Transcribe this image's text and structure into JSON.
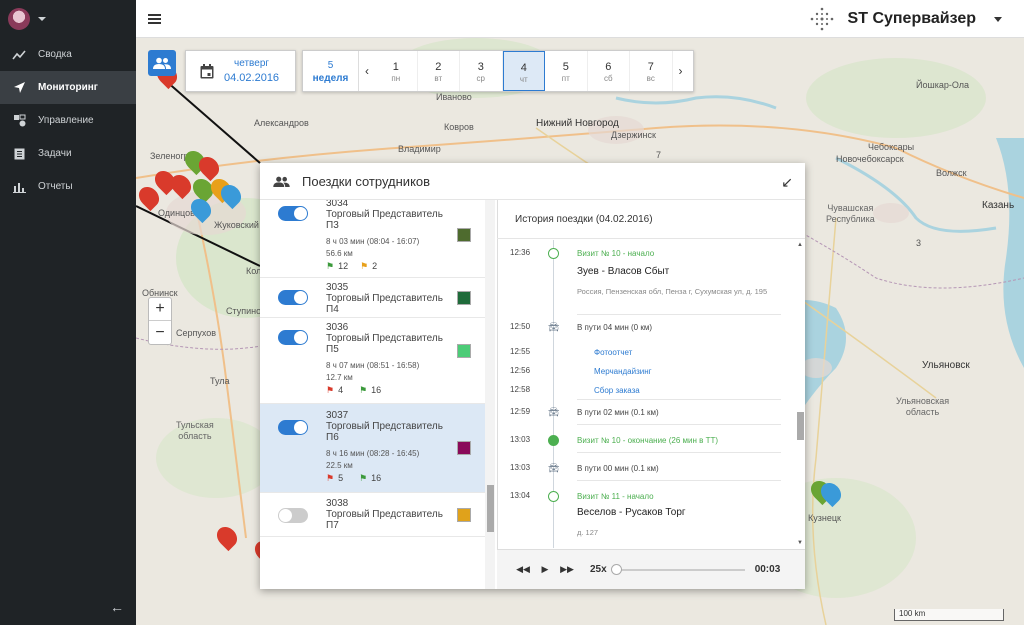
{
  "app": {
    "brand_name": "ST Супервайзер"
  },
  "sidebar": {
    "items": [
      {
        "label": "Сводка",
        "icon": "trend-icon"
      },
      {
        "label": "Мониторинг",
        "icon": "navigation-arrow-icon",
        "active": true
      },
      {
        "label": "Управление",
        "icon": "management-icon"
      },
      {
        "label": "Задачи",
        "icon": "clipboard-icon"
      },
      {
        "label": "Отчеты",
        "icon": "bar-chart-icon"
      }
    ]
  },
  "date_picker": {
    "weekday": "четверг",
    "date": "04.02.2016"
  },
  "week": {
    "number": "5",
    "label": "неделя",
    "days": [
      {
        "num": "1",
        "name": "пн"
      },
      {
        "num": "2",
        "name": "вт"
      },
      {
        "num": "3",
        "name": "ср"
      },
      {
        "num": "4",
        "name": "чт",
        "active": true
      },
      {
        "num": "5",
        "name": "пт"
      },
      {
        "num": "6",
        "name": "сб"
      },
      {
        "num": "7",
        "name": "вс"
      }
    ]
  },
  "map": {
    "labels": {
      "nizhny": "Нижний Новгород",
      "dzerzhinsk": "Дзержинск",
      "vladimir": "Владимир",
      "kovrov": "Ковров",
      "kazan": "Казань",
      "cheboksary": "Чебоксары",
      "novocheboksarsk": "Новочебоксарск",
      "yoshkar": "Йошкар-Ола",
      "volzhsk": "Волжск",
      "chuvash": "Чувашская\nРеспублика",
      "ulyanovsk": "Ульяновск",
      "ulyanovsk_obl": "Ульяновская\nобласть",
      "tula_obl": "Тульская\nобласть",
      "tula": "Тула",
      "kuznetsk": "Кузнецк",
      "aleksandrov": "Александров",
      "zhukovsky": "Жуковский",
      "odintsovo": "Одинцово",
      "zelenograd": "Зеленоград",
      "stupino": "Ступино",
      "kolomna": "Коломна",
      "serpukhov": "Серпухов",
      "obninsk": "Обнинск",
      "ivanovo": "Иваново",
      "r7": "7",
      "r3": "3",
      "scale": "100 km"
    }
  },
  "panel": {
    "title": "Поездки сотрудников",
    "employees": [
      {
        "code": "3034",
        "role": "Торговый Представитель П3",
        "duration": "8 ч 03 мин (08:04 - 16:07)",
        "distance": "56.6 км",
        "flag_a": "12",
        "flag_b": "2",
        "color": "#4e6b2e",
        "on": true,
        "flag_a_type": "green",
        "flag_b_type": "yellow"
      },
      {
        "code": "3035",
        "role": "Торговый Представитель П4",
        "duration": "",
        "distance": "",
        "flag_a": "",
        "flag_b": "",
        "color": "#1f6b3a",
        "on": true
      },
      {
        "code": "3036",
        "role": "Торговый Представитель П5",
        "duration": "8 ч 07 мин (08:51 - 16:58)",
        "distance": "12.7 км",
        "flag_a": "4",
        "flag_b": "16",
        "color": "#4ccc77",
        "on": true,
        "flag_a_type": "red",
        "flag_b_type": "green"
      },
      {
        "code": "3037",
        "role": "Торговый Представитель П6",
        "duration": "8 ч 16 мин (08:28 - 16:45)",
        "distance": "22.5 км",
        "flag_a": "5",
        "flag_b": "16",
        "color": "#8a0a5a",
        "on": true,
        "selected": true,
        "flag_a_type": "red",
        "flag_b_type": "green"
      },
      {
        "code": "3038",
        "role": "Торговый Представитель П7",
        "duration": "",
        "distance": "",
        "flag_a": "",
        "flag_b": "",
        "color": "#e0a21b",
        "on": false
      }
    ]
  },
  "history": {
    "title": "История поездки (04.02.2016)",
    "events": [
      {
        "time": "12:36",
        "kind": "visit-start",
        "text": "Визит № 10 - начало",
        "name": "Зуев - Власов Сбыт",
        "addr": "Россия, Пензенская обл, Пенза г, Сухумская ул, д. 195"
      },
      {
        "time": "12:50",
        "kind": "drive",
        "text": "В пути 04 мин (0 км)"
      },
      {
        "time": "12:55",
        "kind": "task",
        "text": "Фотоотчет"
      },
      {
        "time": "12:56",
        "kind": "task",
        "text": "Мерчандайзинг"
      },
      {
        "time": "12:58",
        "kind": "task",
        "text": "Сбор заказа"
      },
      {
        "time": "12:59",
        "kind": "drive",
        "text": "В пути 02 мин (0.1 км)"
      },
      {
        "time": "13:03",
        "kind": "visit-end",
        "text": "Визит № 10 - окончание (26 мин в ТТ)"
      },
      {
        "time": "13:03",
        "kind": "drive",
        "text": "В пути 00 мин (0.1 км)"
      },
      {
        "time": "13:04",
        "kind": "visit-start",
        "text": "Визит № 11 - начало",
        "name": "Веселов - Русаков Торг",
        "addr": "д. 127"
      }
    ]
  },
  "player": {
    "speed": "25x",
    "time": "00:03"
  },
  "colors": {
    "accent": "#2d7bd1",
    "sidebar_bg": "#1f2326",
    "visit_green": "#4caf50"
  }
}
